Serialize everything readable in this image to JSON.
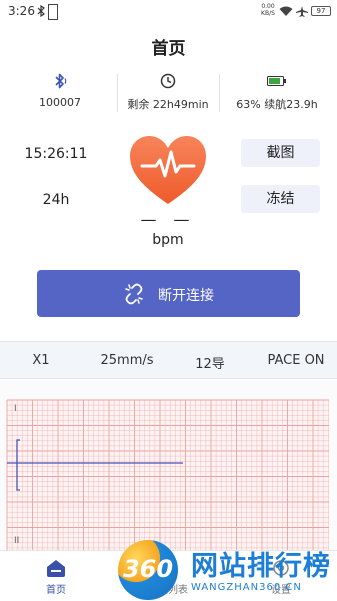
{
  "statusbar": {
    "time": "3:26",
    "rate_value": "0.00",
    "rate_unit": "KB/S",
    "battery": "97"
  },
  "header": {
    "title": "首页"
  },
  "device_info": [
    {
      "icon": "bluetooth-icon",
      "text": "100007"
    },
    {
      "icon": "clock-icon",
      "text": "剩余 22h49min"
    },
    {
      "icon": "battery-icon",
      "text": "63% 续航23.9h"
    }
  ],
  "heart_panel": {
    "current_time": "15:26:11",
    "range": "24h",
    "heart_rate": "— —",
    "unit": "bpm",
    "screenshot_label": "截图",
    "freeze_label": "冻结"
  },
  "connection": {
    "disconnect_label": "断开连接"
  },
  "ecg_settings": {
    "gain": "X1",
    "speed": "25mm/s",
    "leads": "12导",
    "pace": "PACE ON"
  },
  "ecg_leads": [
    "I",
    "II"
  ],
  "bottom_nav": [
    {
      "label": "首页",
      "icon": "home-icon",
      "active": true
    },
    {
      "label": "心电列表",
      "icon": "list-icon",
      "active": false
    },
    {
      "label": "设置",
      "icon": "settings-icon",
      "active": false
    }
  ],
  "watermark": {
    "number": "360",
    "title": "网站排行榜",
    "subtitle": "WANGZHAN360.CN"
  },
  "colors": {
    "accent": "#5565c6",
    "heart": "#f06a3c",
    "ecg_grid": "#f0a0a0",
    "ecg_trace": "#4a52b8"
  }
}
